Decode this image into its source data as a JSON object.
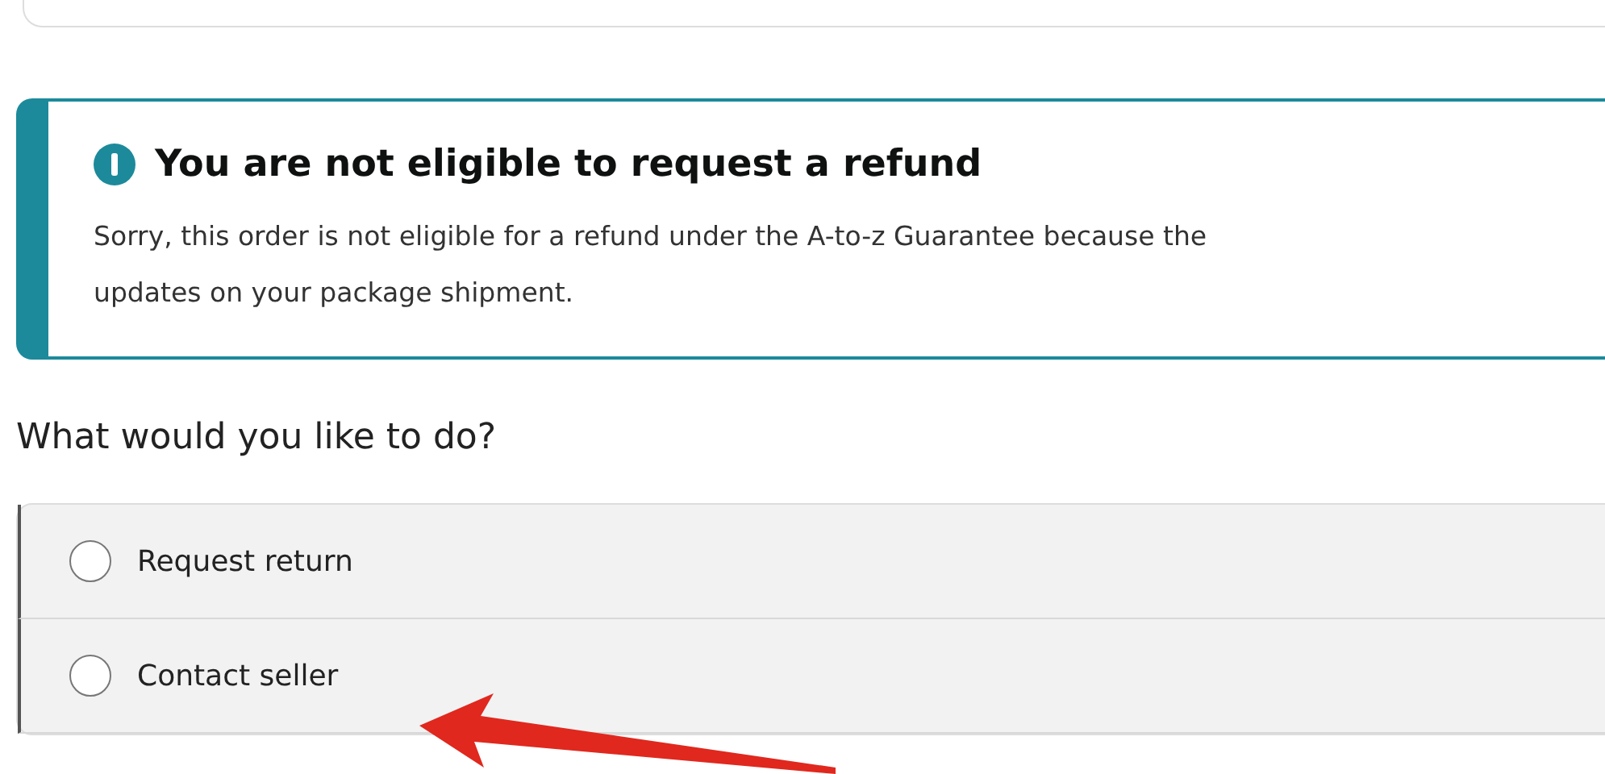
{
  "alert": {
    "title": "You are not eligible to request a refund",
    "message_lines": [
      "Sorry, this order is not eligible for a refund under the A-to-z Guarantee because the",
      "updates on your package shipment."
    ]
  },
  "question": "What would you like to do?",
  "options": [
    {
      "label": "Request return",
      "selected": false
    },
    {
      "label": "Contact seller",
      "selected": false
    }
  ]
}
